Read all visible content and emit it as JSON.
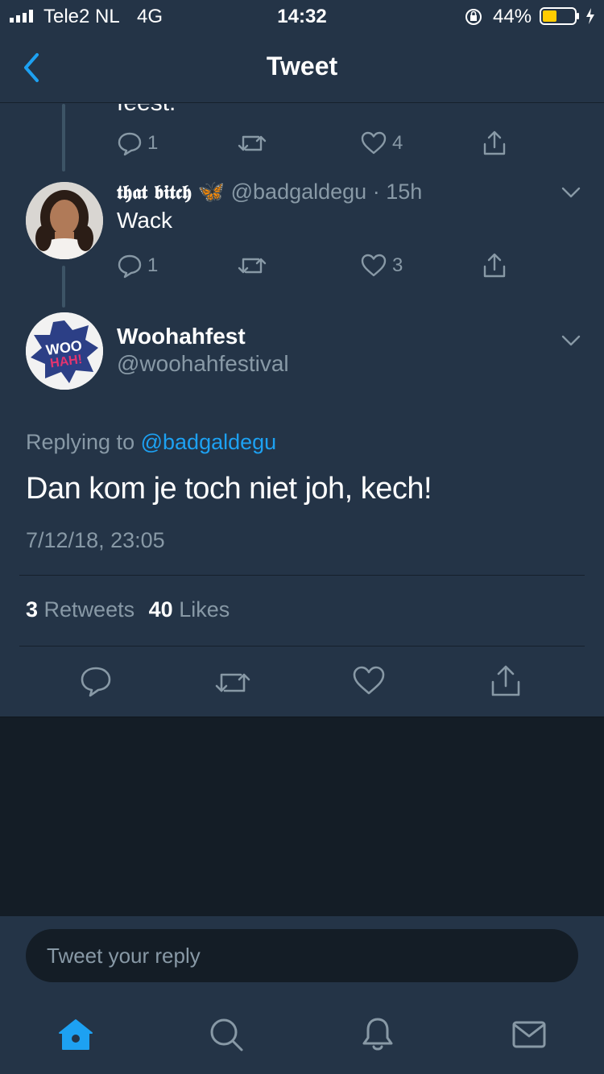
{
  "status_bar": {
    "carrier": "Tele2 NL",
    "network": "4G",
    "time": "14:32",
    "battery_percent": "44%",
    "battery_level": 0.44,
    "icons": [
      "signal-icon",
      "orientation-lock-icon",
      "battery-icon",
      "charging-icon"
    ]
  },
  "header": {
    "title": "Tweet",
    "back_icon": "chevron-left-icon"
  },
  "previous_tweet": {
    "partial_text": "feest.",
    "reply_count": "1",
    "like_count": "4"
  },
  "parent_tweet": {
    "display_name": "𝖙𝖍𝖆𝖙 𝖇𝖎𝖙𝖈𝖍",
    "emoji": "🦋",
    "handle": "@badgaldegu",
    "separator": "·",
    "time_ago": "15h",
    "text": "Wack",
    "reply_count": "1",
    "like_count": "3"
  },
  "main_tweet": {
    "display_name": "Woohahfest",
    "handle": "@woohahfestival",
    "avatar_logo": "WOO HAH!",
    "replying_prefix": "Replying to",
    "replying_handle": "@badgaldegu",
    "text": "Dan kom je toch niet joh, kech!",
    "timestamp": "7/12/18, 23:05",
    "retweets_count": "3",
    "retweets_label": "Retweets",
    "likes_count": "40",
    "likes_label": "Likes"
  },
  "reply_bar": {
    "placeholder": "Tweet your reply"
  },
  "tab_bar": {
    "active": "home",
    "items": [
      "home-icon",
      "search-icon",
      "notifications-icon",
      "messages-icon"
    ]
  },
  "colors": {
    "background": "#243447",
    "dark_background": "#141d26",
    "accent": "#1da1f2",
    "secondary_text": "#8899a6",
    "battery_fill": "#ffcc00"
  }
}
